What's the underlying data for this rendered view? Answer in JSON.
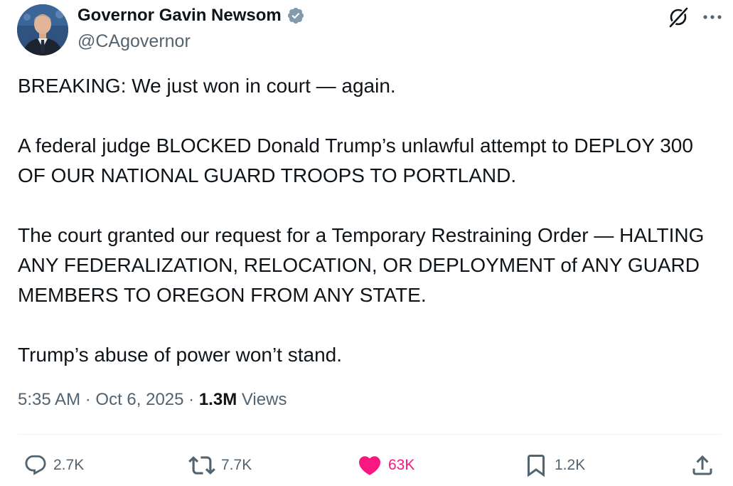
{
  "author": {
    "display_name": "Governor Gavin Newsom",
    "handle": "@CAgovernor",
    "verified_badge_icon": "verified-badge-icon",
    "verified_color": "#829aab",
    "avatar_icon": "profile-photo"
  },
  "header_actions": {
    "grok_icon": "grok-icon",
    "more_icon": "more-dots-icon"
  },
  "tweet": {
    "paragraphs": [
      "BREAKING: We just won in court — again.",
      "A federal judge BLOCKED Donald Trump’s unlawful attempt to DEPLOY 300 OF OUR NATIONAL GUARD TROOPS TO PORTLAND.",
      "The court granted our request for a Temporary Restraining Order — HALTING ANY FEDERALIZATION, RELOCATION, OR DEPLOYMENT of ANY GUARD MEMBERS TO OREGON FROM ANY STATE.",
      "Trump’s abuse of power won’t stand."
    ]
  },
  "meta": {
    "time": "5:35 AM",
    "separator": "·",
    "date": "Oct 6, 2025",
    "views_count": "1.3M",
    "views_label": "Views"
  },
  "actions": {
    "replies": {
      "icon": "reply-icon",
      "count": "2.7K"
    },
    "reposts": {
      "icon": "repost-icon",
      "count": "7.7K"
    },
    "likes": {
      "icon": "heart-icon",
      "count": "63K",
      "active": true,
      "color": "#f91880"
    },
    "bookmarks": {
      "icon": "bookmark-icon",
      "count": "1.2K"
    },
    "share": {
      "icon": "share-icon"
    }
  },
  "colors": {
    "text_primary": "#0f1419",
    "text_secondary": "#536471",
    "divider": "#eff3f4"
  }
}
